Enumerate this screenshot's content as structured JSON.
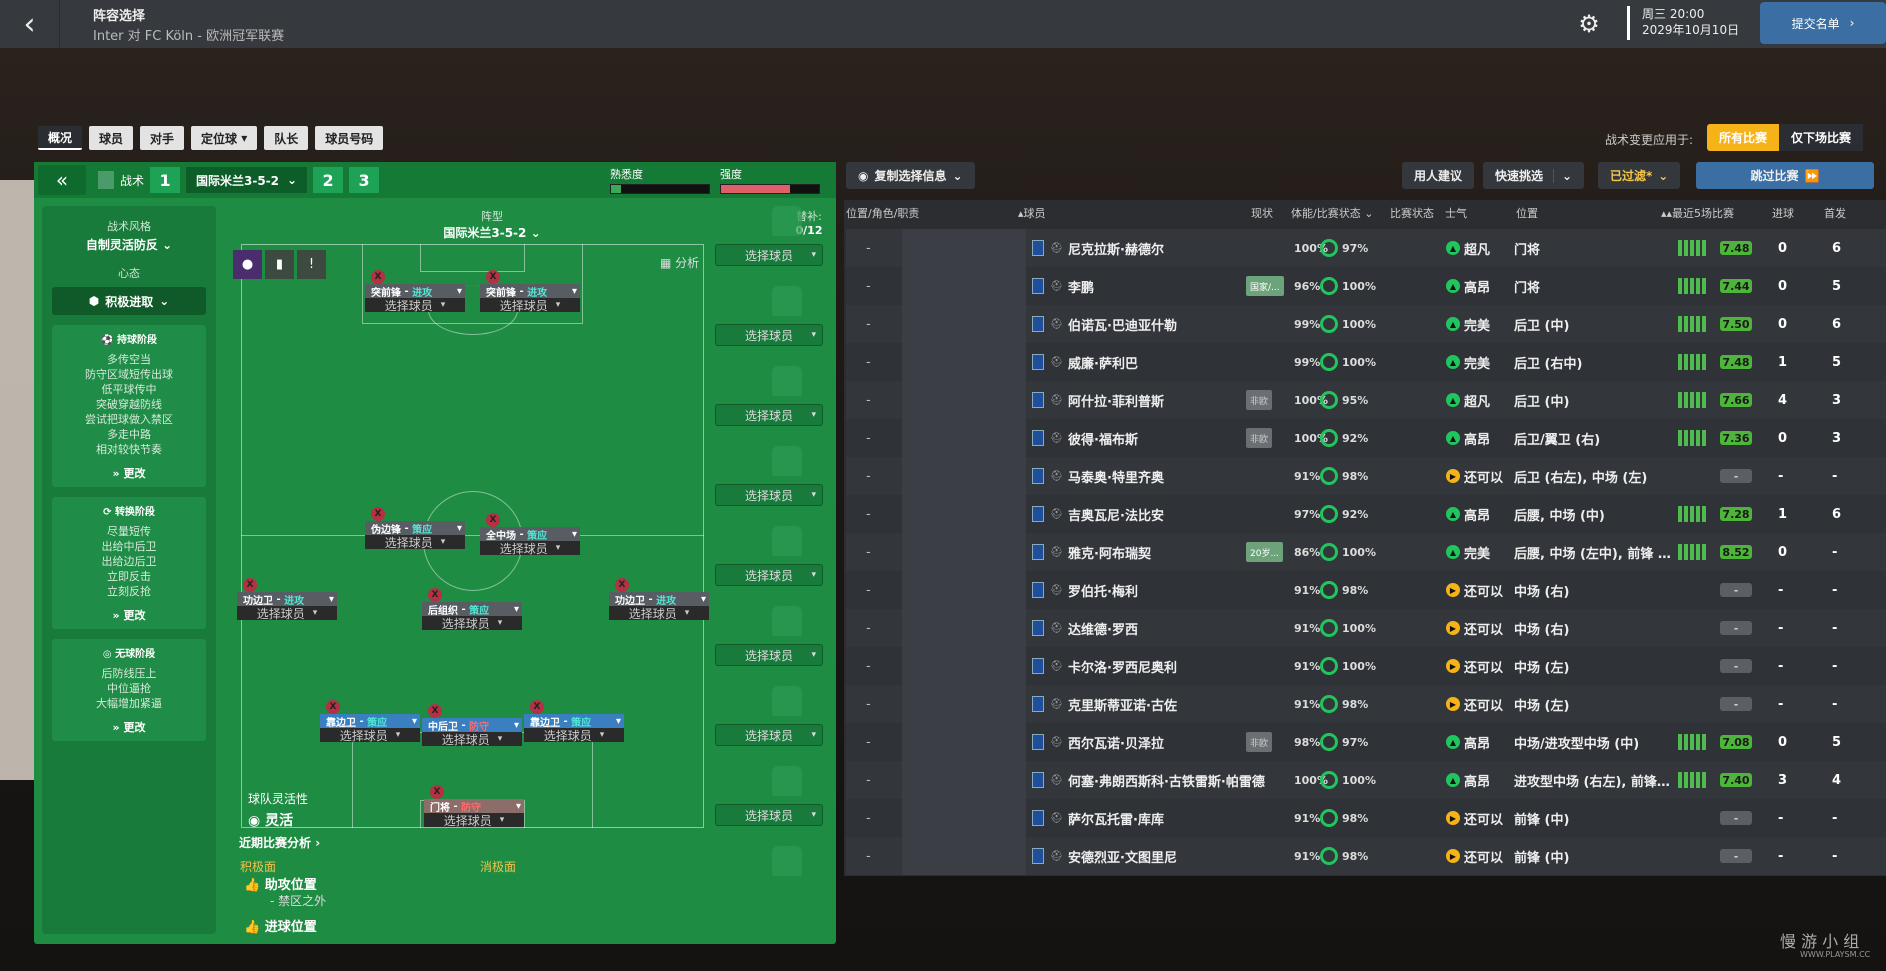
{
  "header": {
    "title": "阵容选择",
    "subtitle": "Inter 对 FC Köln - 欧洲冠军联赛",
    "day": "周三 20:00",
    "date": "2029年10月10日",
    "submit": "提交名单"
  },
  "tabs": [
    "概况",
    "球员",
    "对手",
    "定位球",
    "队长",
    "球员号码"
  ],
  "apply": {
    "label": "战术变更应用于:",
    "opt1": "所有比赛",
    "opt2": "仅下场比赛"
  },
  "tactic": {
    "label": "战术",
    "slot1": "1",
    "name": "国际米兰3-5-2",
    "slot2": "2",
    "slot3": "3",
    "familiarity": "熟悉度",
    "intensity": "强度"
  },
  "side": {
    "style_h": "战术风格",
    "style": "自制灵活防反",
    "mind_h": "心态",
    "mind": "积极进取",
    "in_h": "持球阶段",
    "in": [
      "多传空当",
      "防守区域短传出球",
      "低平球传中",
      "突破穿越防线",
      "尝试把球做入禁区",
      "多走中路",
      "相对较快节奏"
    ],
    "tr_h": "转换阶段",
    "tr": [
      "尽量短传",
      "出给中后卫",
      "出给边后卫",
      "立即反击",
      "立刻反抢"
    ],
    "out_h": "无球阶段",
    "out": [
      "后防线压上",
      "中位逼抢",
      "大幅增加紧逼"
    ],
    "more": "更改"
  },
  "pitch": {
    "label": "阵型",
    "name": "国际米兰3-5-2",
    "analyze": "分析",
    "flex_h": "球队灵活性",
    "flex": "灵活",
    "recent": "近期比赛分析",
    "pos_h": "积极面",
    "neg_h": "消极面",
    "p1": "助攻位置",
    "p1b": "- 禁区之外",
    "p2": "进球位置"
  },
  "select": "选择球员",
  "positions": [
    {
      "role": "突前锋",
      "duty": "进攻",
      "red": false,
      "cls": ""
    },
    {
      "role": "突前锋",
      "duty": "进攻",
      "red": false,
      "cls": ""
    },
    {
      "role": "伪边锋",
      "duty": "策应",
      "red": false,
      "cls": ""
    },
    {
      "role": "全中场",
      "duty": "策应",
      "red": false,
      "cls": ""
    },
    {
      "role": "功边卫",
      "duty": "进攻",
      "red": false,
      "cls": ""
    },
    {
      "role": "后组织",
      "duty": "策应",
      "red": false,
      "cls": ""
    },
    {
      "role": "功边卫",
      "duty": "进攻",
      "red": false,
      "cls": ""
    },
    {
      "role": "靠边卫",
      "duty": "策应",
      "red": false,
      "cls": "def"
    },
    {
      "role": "中后卫",
      "duty": "防守",
      "red": true,
      "cls": "def"
    },
    {
      "role": "靠边卫",
      "duty": "策应",
      "red": false,
      "cls": "def"
    },
    {
      "role": "门将",
      "duty": "防守",
      "red": true,
      "cls": "gk"
    }
  ],
  "subs": {
    "label": "替补:",
    "count": "0/12"
  },
  "toolbar": {
    "copy": "复制选择信息",
    "advice": "用人建议",
    "quick": "快速挑选",
    "filter": "已过滤*",
    "skip": "跳过比赛"
  },
  "cols": {
    "pos": "位置/角色/职责",
    "player": "球员",
    "cond": "现状",
    "fit": "体能/比赛状态",
    "sharp": "比赛状态",
    "morale": "士气",
    "position": "位置",
    "last5": "最近5场比赛",
    "goals": "进球",
    "apps": "首发"
  },
  "players": [
    {
      "name": "尼克拉斯·赫德尔",
      "cond": "",
      "fit": "100%",
      "sharp": "97%",
      "mor": "超凡",
      "mc": "#21c55d",
      "pos": "门将",
      "rating": "7.48",
      "gl": "0",
      "ap": "6"
    },
    {
      "name": "李鹏",
      "cond": "国家/...",
      "fit": "96%",
      "sharp": "100%",
      "mor": "高昂",
      "mc": "#21c55d",
      "pos": "门将",
      "rating": "7.44",
      "gl": "0",
      "ap": "5"
    },
    {
      "name": "伯诺瓦·巴迪亚什勒",
      "cond": "",
      "fit": "99%",
      "sharp": "100%",
      "mor": "完美",
      "mc": "#21c55d",
      "pos": "后卫 (中)",
      "rating": "7.50",
      "gl": "0",
      "ap": "6"
    },
    {
      "name": "威廉·萨利巴",
      "cond": "",
      "fit": "99%",
      "sharp": "100%",
      "mor": "完美",
      "mc": "#21c55d",
      "pos": "后卫 (右中)",
      "rating": "7.48",
      "gl": "1",
      "ap": "5"
    },
    {
      "name": "阿什拉·菲利普斯",
      "cond": "非欧",
      "fit": "100%",
      "sharp": "95%",
      "mor": "超凡",
      "mc": "#21c55d",
      "pos": "后卫 (中)",
      "rating": "7.66",
      "gl": "4",
      "ap": "3"
    },
    {
      "name": "彼得·福布斯",
      "cond": "非欧",
      "fit": "100%",
      "sharp": "92%",
      "mor": "高昂",
      "mc": "#21c55d",
      "pos": "后卫/翼卫 (右)",
      "rating": "7.36",
      "gl": "0",
      "ap": "3"
    },
    {
      "name": "马泰奥·特里齐奥",
      "cond": "",
      "fit": "91%",
      "sharp": "98%",
      "mor": "还可以",
      "mc": "#f6b318",
      "pos": "后卫 (右左), 中场 (左)",
      "rating": "-",
      "gl": "-",
      "ap": "-"
    },
    {
      "name": "吉奥瓦尼·法比安",
      "cond": "",
      "fit": "97%",
      "sharp": "92%",
      "mor": "高昂",
      "mc": "#21c55d",
      "pos": "后腰, 中场 (中)",
      "rating": "7.28",
      "gl": "1",
      "ap": "6"
    },
    {
      "name": "雅克·阿布瑞契",
      "cond": "20岁...",
      "fit": "86%",
      "sharp": "100%",
      "mor": "完美",
      "mc": "#21c55d",
      "pos": "后腰, 中场 (左中), 前锋 (中)",
      "rating": "8.52",
      "gl": "0",
      "ap": "-"
    },
    {
      "name": "罗伯托·梅利",
      "cond": "",
      "fit": "91%",
      "sharp": "98%",
      "mor": "还可以",
      "mc": "#f6b318",
      "pos": "中场 (右)",
      "rating": "-",
      "gl": "-",
      "ap": "-"
    },
    {
      "name": "达维德·罗西",
      "cond": "",
      "fit": "91%",
      "sharp": "100%",
      "mor": "还可以",
      "mc": "#f6b318",
      "pos": "中场 (右)",
      "rating": "-",
      "gl": "-",
      "ap": "-"
    },
    {
      "name": "卡尔洛·罗西尼奥利",
      "cond": "",
      "fit": "91%",
      "sharp": "100%",
      "mor": "还可以",
      "mc": "#f6b318",
      "pos": "中场 (左)",
      "rating": "-",
      "gl": "-",
      "ap": "-"
    },
    {
      "name": "克里斯蒂亚诺·古佐",
      "cond": "",
      "fit": "91%",
      "sharp": "98%",
      "mor": "还可以",
      "mc": "#f6b318",
      "pos": "中场 (左)",
      "rating": "-",
      "gl": "-",
      "ap": "-"
    },
    {
      "name": "西尔瓦诺·贝泽拉",
      "cond": "非欧",
      "fit": "98%",
      "sharp": "97%",
      "mor": "高昂",
      "mc": "#21c55d",
      "pos": "中场/进攻型中场 (中)",
      "rating": "7.08",
      "gl": "0",
      "ap": "5"
    },
    {
      "name": "何塞·弗朗西斯科·古铁雷斯·帕雷德",
      "cond": "",
      "fit": "100%",
      "sharp": "100%",
      "mor": "高昂",
      "mc": "#21c55d",
      "pos": "进攻型中场 (右左), 前锋 (...",
      "rating": "7.40",
      "gl": "3",
      "ap": "4"
    },
    {
      "name": "萨尔瓦托雷·库库",
      "cond": "",
      "fit": "91%",
      "sharp": "98%",
      "mor": "还可以",
      "mc": "#f6b318",
      "pos": "前锋 (中)",
      "rating": "-",
      "gl": "-",
      "ap": "-"
    },
    {
      "name": "安德烈亚·文图里尼",
      "cond": "",
      "fit": "91%",
      "sharp": "98%",
      "mor": "还可以",
      "mc": "#f6b318",
      "pos": "前锋 (中)",
      "rating": "-",
      "gl": "-",
      "ap": "-"
    }
  ],
  "watermark": "慢 游 小 组",
  "watermark2": "WWW.PLAYSM.CC"
}
